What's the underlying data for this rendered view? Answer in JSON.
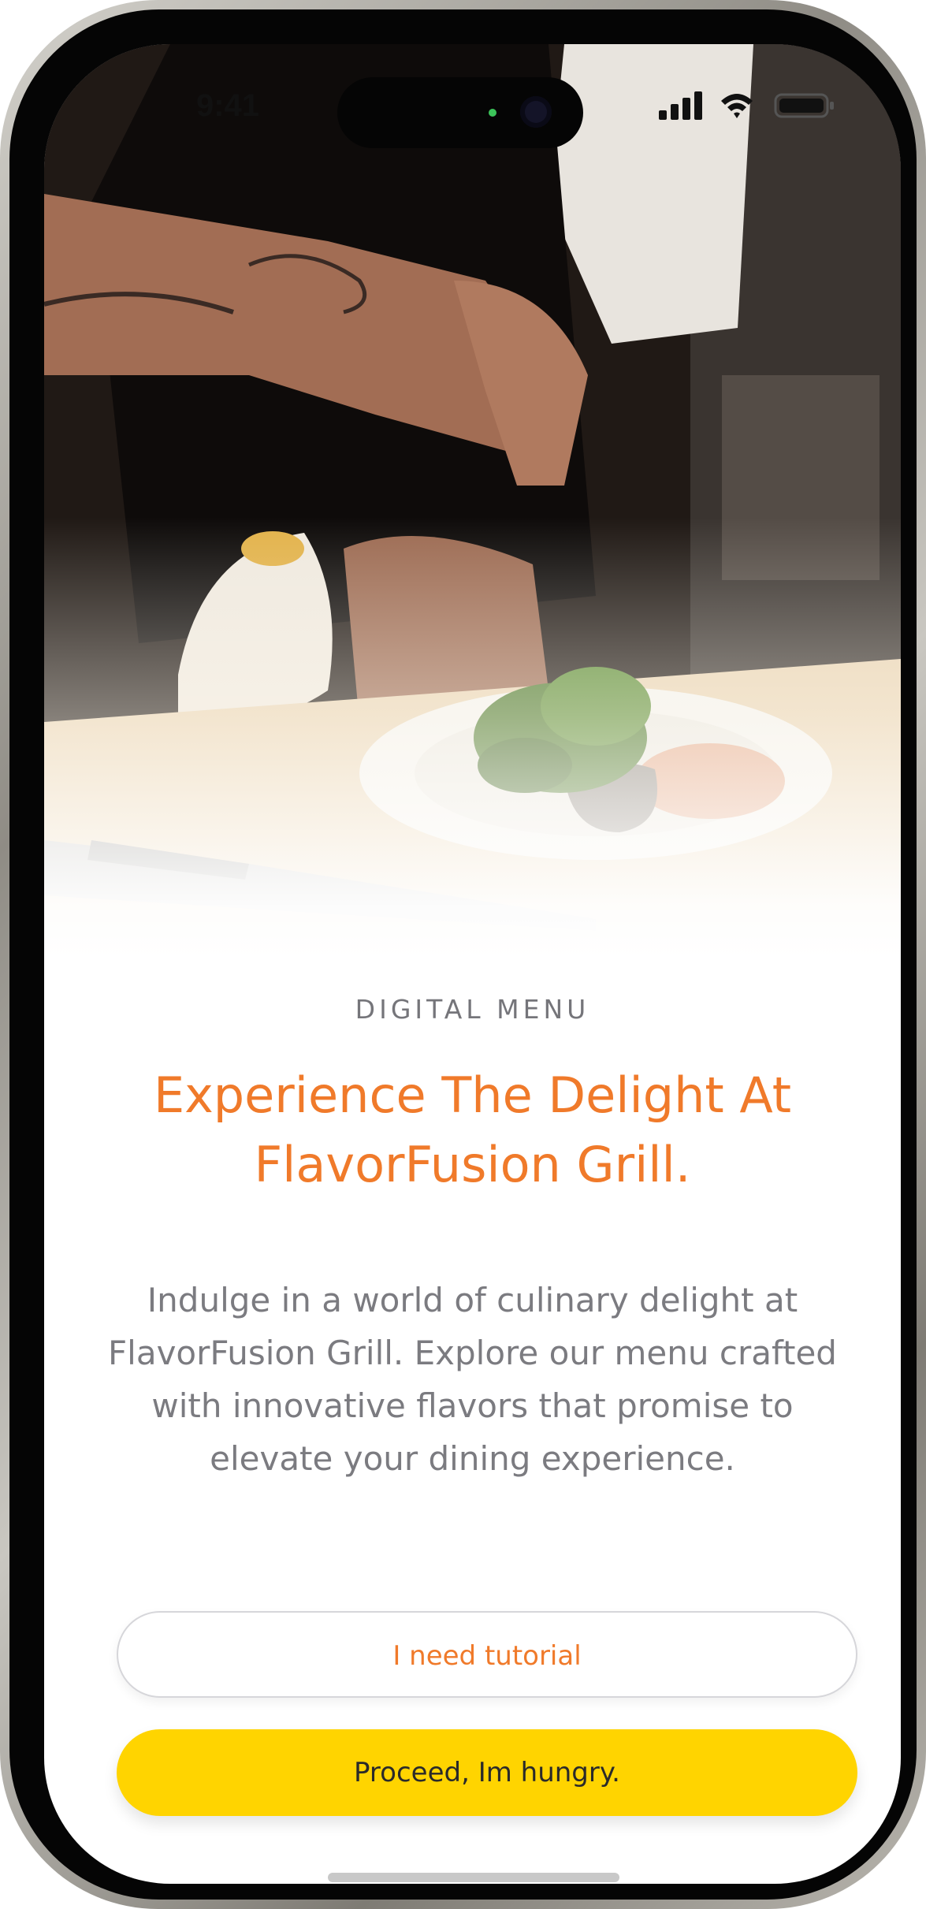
{
  "status_bar": {
    "time": "9:41"
  },
  "hero": {
    "image_alt_icon": "chef-plating-dish-image"
  },
  "content": {
    "eyebrow": "DIGITAL MENU",
    "headline_line1": "Experience The Delight At",
    "headline_line2": "FlavorFusion Grill.",
    "description": "Indulge in a world of culinary delight at FlavorFusion Grill. Explore our menu crafted with innovative flavors that promise to elevate your dining experience."
  },
  "actions": {
    "tutorial_label": "I need tutorial",
    "proceed_label": "Proceed, Im hungry."
  },
  "colors": {
    "accent_orange": "#f07a2a",
    "primary_yellow": "#ffd400",
    "text_gray": "#7b7b80"
  }
}
